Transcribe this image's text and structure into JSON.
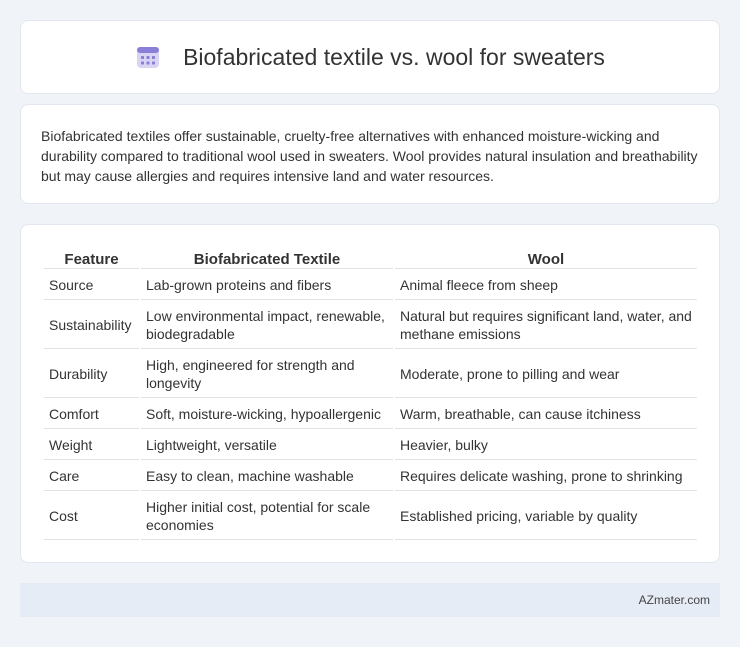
{
  "header": {
    "title": "Biofabricated textile vs. wool for sweaters",
    "icon": "calendar-icon"
  },
  "summary": {
    "text": "Biofabricated textiles offer sustainable, cruelty-free alternatives with enhanced moisture-wicking and durability compared to traditional wool used in sweaters. Wool provides natural insulation and breathability but may cause allergies and requires intensive land and water resources."
  },
  "table": {
    "headers": [
      "Feature",
      "Biofabricated Textile",
      "Wool"
    ],
    "rows": [
      [
        "Source",
        "Lab-grown proteins and fibers",
        "Animal fleece from sheep"
      ],
      [
        "Sustainability",
        "Low environmental impact, renewable, biodegradable",
        "Natural but requires significant land, water, and methane emissions"
      ],
      [
        "Durability",
        "High, engineered for strength and longevity",
        "Moderate, prone to pilling and wear"
      ],
      [
        "Comfort",
        "Soft, moisture-wicking, hypoallergenic",
        "Warm, breathable, can cause itchiness"
      ],
      [
        "Weight",
        "Lightweight, versatile",
        "Heavier, bulky"
      ],
      [
        "Care",
        "Easy to clean, machine washable",
        "Requires delicate washing, prone to shrinking"
      ],
      [
        "Cost",
        "Higher initial cost, potential for scale economies",
        "Established pricing, variable by quality"
      ]
    ]
  },
  "footer": {
    "text": "AZmater.com"
  },
  "colors": {
    "background": "#f0f3f8",
    "card": "#ffffff",
    "footer": "#e6ecf5",
    "icon_accent": "#8a7fd6"
  }
}
